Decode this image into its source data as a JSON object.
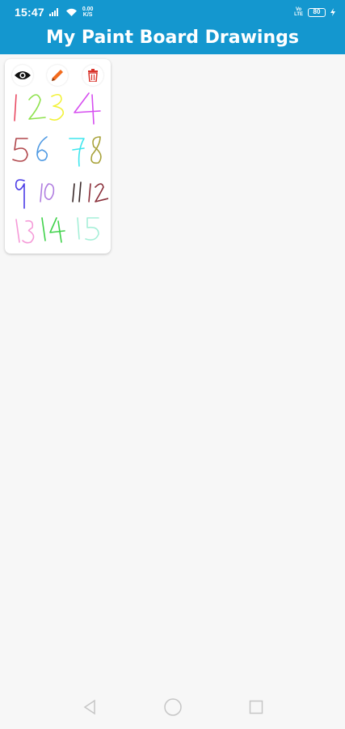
{
  "status_bar": {
    "time": "15:47",
    "net_speed": "0.00",
    "net_speed_unit": "K/S",
    "volte_top": "Vo",
    "volte_bottom": "LTE",
    "battery_level": "80"
  },
  "app_bar": {
    "title": "My Paint Board Drawings"
  },
  "drawings": [
    {
      "actions": [
        {
          "name": "view",
          "icon": "eye-icon",
          "color": "#111111"
        },
        {
          "name": "edit",
          "icon": "pencil-icon",
          "color": "#f26b1d"
        },
        {
          "name": "delete",
          "icon": "trash-icon",
          "color": "#d9342b"
        }
      ],
      "handwritten_digits": [
        {
          "text": "1",
          "color": "#e94b63"
        },
        {
          "text": "2",
          "color": "#8ee24c"
        },
        {
          "text": "3",
          "color": "#f2f23a"
        },
        {
          "text": "4",
          "color": "#d64ef0"
        },
        {
          "text": "5",
          "color": "#b0464b"
        },
        {
          "text": "6",
          "color": "#4f9ae3"
        },
        {
          "text": "7",
          "color": "#3ee6ee"
        },
        {
          "text": "8",
          "color": "#a8a23a"
        },
        {
          "text": "9",
          "color": "#4a3be6"
        },
        {
          "text": "10",
          "color": "#b07de0"
        },
        {
          "text": "11",
          "color": "#3a2a2a"
        },
        {
          "text": "12",
          "color": "#8a2f3a"
        },
        {
          "text": "13",
          "color": "#f59ad8"
        },
        {
          "text": "14",
          "color": "#3fd24a"
        },
        {
          "text": "15",
          "color": "#a6efd8"
        }
      ]
    }
  ],
  "nav_bar": {
    "back_icon": "back-triangle-icon",
    "home_icon": "home-circle-icon",
    "recents_icon": "recents-square-icon"
  }
}
